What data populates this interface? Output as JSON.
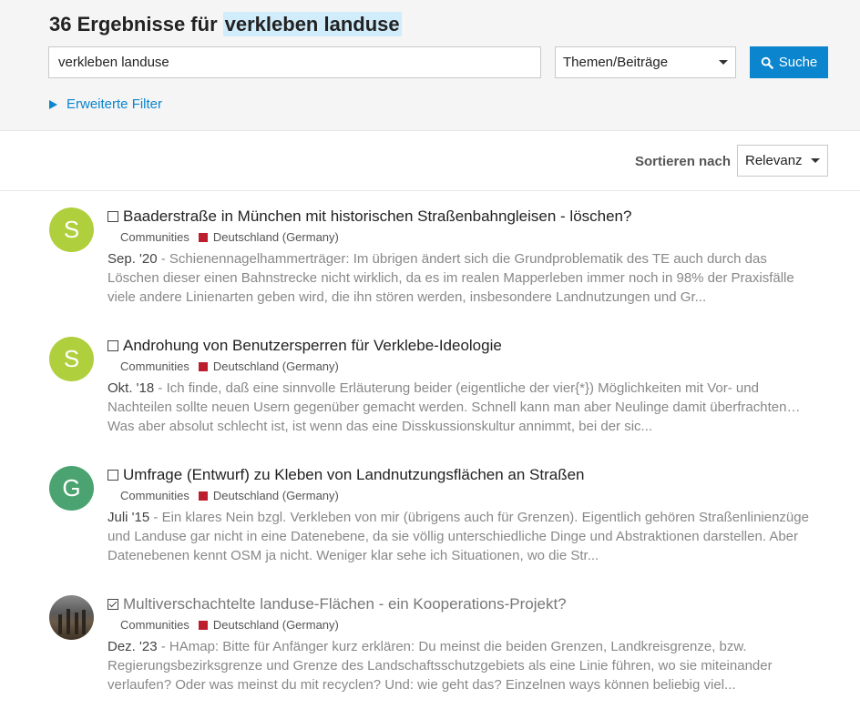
{
  "header": {
    "count_text": "36 Ergebnisse für",
    "term": "verkleben landuse"
  },
  "search": {
    "value": "verkleben landuse",
    "type_selected": "Themen/Beiträge",
    "button_label": "Suche",
    "advanced_filter_label": "Erweiterte Filter"
  },
  "sort": {
    "label": "Sortieren nach",
    "selected": "Relevanz"
  },
  "colors": {
    "accent": "#0a85ce",
    "category": "#bd1e2d",
    "avatar_s": "#b0cf3c",
    "avatar_g": "#4aa370"
  },
  "results": [
    {
      "avatar_letter": "S",
      "title": "Baaderstraße in München mit historischen Straßenbahngleisen - löschen?",
      "category": "Communities",
      "subcategory": "Deutschland (Germany)",
      "date": "Sep. '20",
      "excerpt": "Schienennagelhammerträger: Im übrigen ändert sich die Grundproblematik des TE auch durch das Löschen dieser einen Bahnstrecke nicht wirklich, da es im realen Mapperleben immer noch in 98% der Praxisfälle viele andere Linienarten geben wird, die ihn stören werden, insbesondere Landnutzungen und Gr..."
    },
    {
      "avatar_letter": "S",
      "title": "Androhung von Benutzersperren für Verklebe-Ideologie",
      "category": "Communities",
      "subcategory": "Deutschland (Germany)",
      "date": "Okt. '18",
      "excerpt": "Ich finde, daß eine sinnvolle Erläuterung beider (eigentliche der vier{*}) Möglichkeiten mit Vor- und Nachteilen sollte neuen Usern gegenüber gemacht werden. Schnell kann man aber Neulinge damit überfrachten… Was aber absolut schlecht ist, ist wenn das eine Disskussionskultur annimmt, bei der sic..."
    },
    {
      "avatar_letter": "G",
      "title": "Umfrage (Entwurf) zu Kleben von Landnutzungsflächen an Straßen",
      "category": "Communities",
      "subcategory": "Deutschland (Germany)",
      "date": "Juli '15",
      "excerpt": "Ein klares Nein bzgl. Verkleben von mir (übrigens auch für Grenzen). Eigentlich gehören Straßenlinienzüge und Landuse gar nicht in eine Datenebene, da sie völlig unterschiedliche Dinge und Abstraktionen darstellen. Aber Datenebenen kennt OSM ja nicht. Weniger klar sehe ich Situationen, wo die Str..."
    },
    {
      "avatar_letter": "",
      "title": "Multiverschachtelte landuse-Flächen - ein Kooperations-Projekt?",
      "category": "Communities",
      "subcategory": "Deutschland (Germany)",
      "date": "Dez. '23",
      "excerpt": "HAmap: Bitte für Anfänger kurz erklären: Du meinst die beiden Grenzen, Landkreisgrenze, bzw. Regierungsbezirksgrenze und Grenze des Landschaftsschutzgebiets als eine Linie führen, wo sie miteinander verlaufen? Oder was meinst du mit recyclen? Und: wie geht das? Einzelnen ways können beliebig viel..."
    }
  ]
}
